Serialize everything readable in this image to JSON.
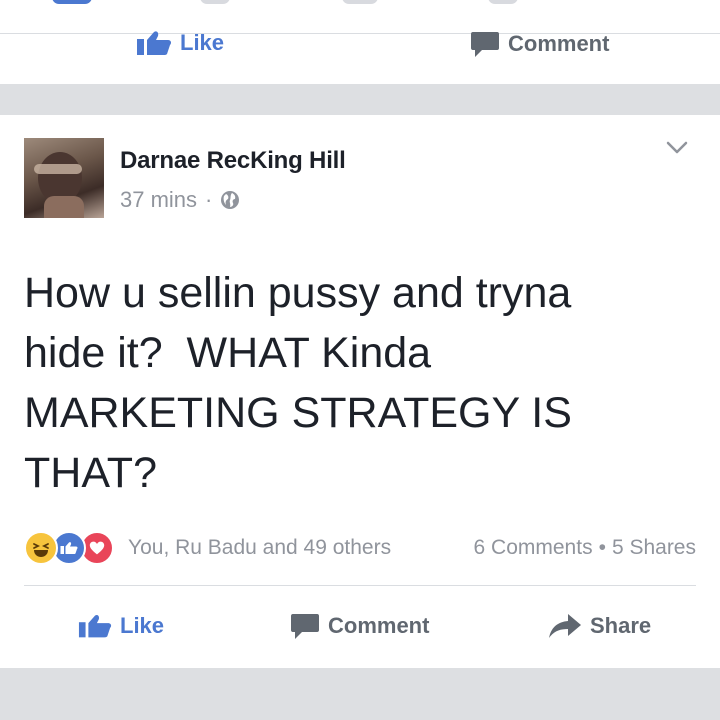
{
  "previous_post": {
    "like_label": "Like",
    "comment_label": "Comment"
  },
  "post": {
    "author": "Darnae RecKing Hill",
    "timestamp": "37 mins",
    "separator": "·",
    "privacy_icon": "globe-icon",
    "text_lines": [
      "How u sellin pussy and tryna",
      "hide it?  WHAT Kinda",
      "MARKETING STRATEGY IS",
      "THAT?"
    ],
    "reactions": [
      "haha-icon",
      "like-reaction-icon",
      "love-icon"
    ],
    "reaction_summary": "You, Ru Badu and 49 others",
    "comments_count": "6 Comments",
    "dot": "•",
    "shares_count": "5 Shares",
    "actions": {
      "like": "Like",
      "comment": "Comment",
      "share": "Share"
    }
  },
  "colors": {
    "like_blue": "#4b78d0",
    "text_dark": "#1d2129",
    "text_grey": "#90949c",
    "background": "#dddfe2"
  }
}
